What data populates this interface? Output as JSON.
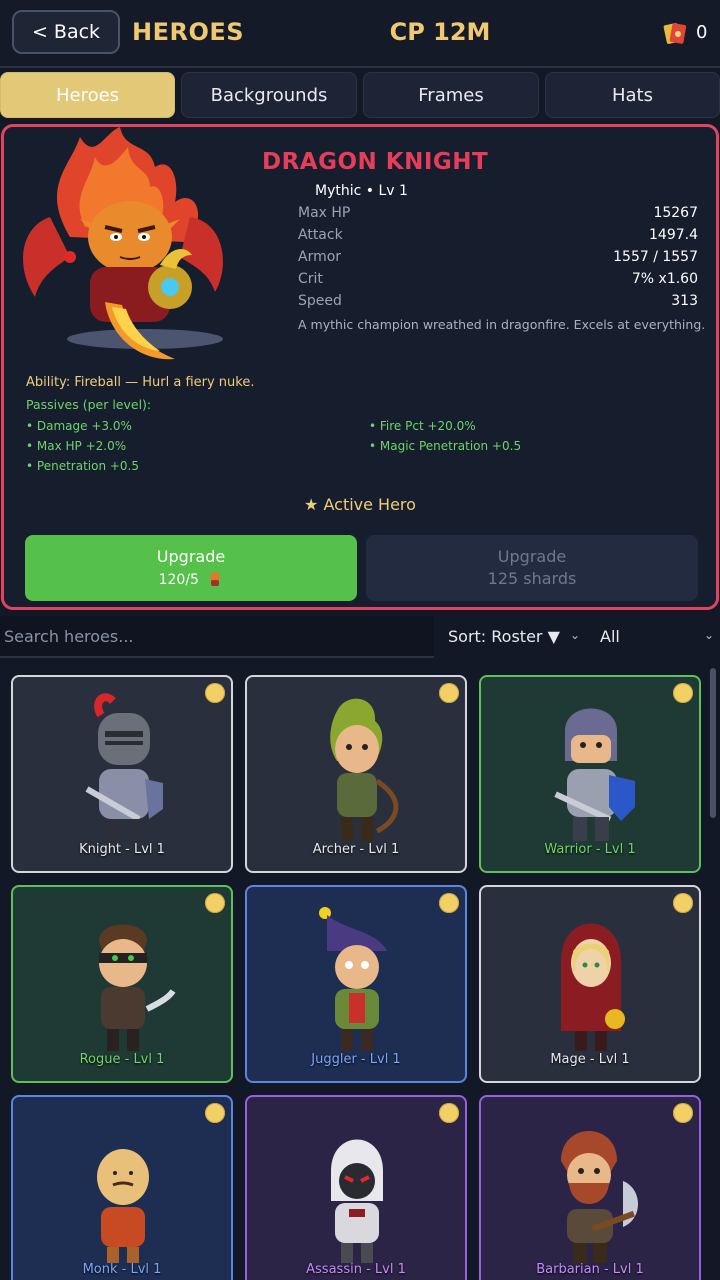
{
  "header": {
    "back_label": "< Back",
    "title": "HEROES",
    "cp": "CP 12M",
    "cards_count": "0"
  },
  "tabs": [
    {
      "label": "Heroes",
      "active": true
    },
    {
      "label": "Backgrounds",
      "active": false
    },
    {
      "label": "Frames",
      "active": false
    },
    {
      "label": "Hats",
      "active": false
    }
  ],
  "hero": {
    "name": "DRAGON KNIGHT",
    "rarity_level": "Mythic  •  Lv 1",
    "stats": [
      {
        "label": "Max HP",
        "value": "15267"
      },
      {
        "label": "Attack",
        "value": "1497.4"
      },
      {
        "label": "Armor",
        "value": "1557 / 1557"
      },
      {
        "label": "Crit",
        "value": "7% x1.60"
      },
      {
        "label": "Speed",
        "value": "313"
      }
    ],
    "description": "A mythic champion wreathed in dragonfire. Excels at everything.",
    "ability": "Ability: Fireball — Hurl a fiery nuke.",
    "passives_title": "Passives (per level):",
    "passives": [
      "•  Damage +3.0%",
      "•  Fire Pct +20.0%",
      "•  Max HP +2.0%",
      "•  Magic Penetration +0.5",
      "•  Penetration +0.5"
    ],
    "active_label": "★ Active Hero",
    "upgrade": {
      "label": "Upgrade",
      "progress": "120/5"
    },
    "upgrade_shards": {
      "label": "Upgrade",
      "cost": "125 shards"
    }
  },
  "search": {
    "placeholder": "Search heroes..."
  },
  "sort": {
    "label": "Sort: Roster ▼"
  },
  "filter": {
    "label": "All"
  },
  "roster": [
    {
      "name": "Knight - Lvl 1",
      "rarity": "common"
    },
    {
      "name": "Archer - Lvl 1",
      "rarity": "common"
    },
    {
      "name": "Warrior - Lvl 1",
      "rarity": "uncommon"
    },
    {
      "name": "Rogue - Lvl 1",
      "rarity": "uncommon"
    },
    {
      "name": "Juggler - Lvl 1",
      "rarity": "rare"
    },
    {
      "name": "Mage - Lvl 1",
      "rarity": "common"
    },
    {
      "name": "Monk - Lvl 1",
      "rarity": "rare"
    },
    {
      "name": "Assassin - Lvl 1",
      "rarity": "epic"
    },
    {
      "name": "Barbarian - Lvl 1",
      "rarity": "epic"
    }
  ],
  "colors": {
    "accent_gold": "#f0c872",
    "hero_name": "#e53d5a",
    "passive_green": "#6fd46a",
    "upgrade_green": "#55c04a"
  }
}
